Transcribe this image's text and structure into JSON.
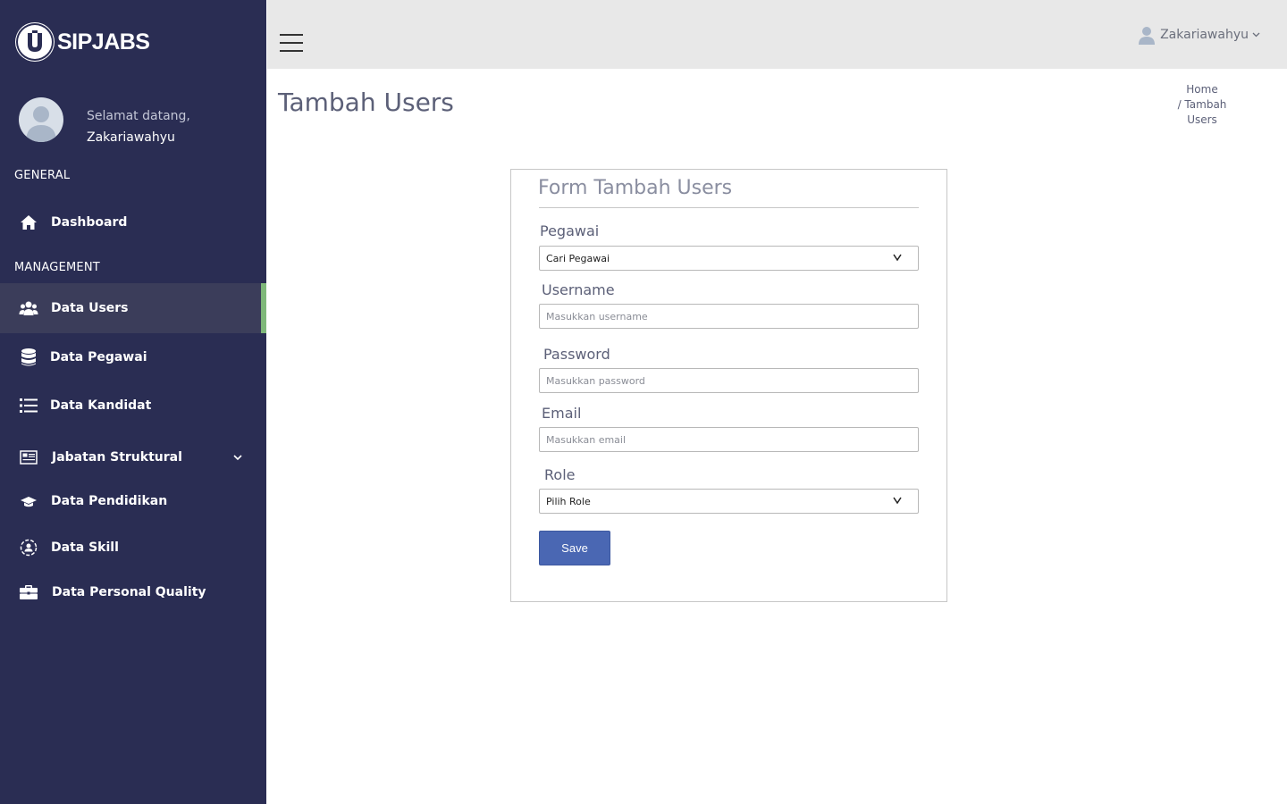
{
  "app": {
    "brand_name": "SIPJABS"
  },
  "sidebar": {
    "welcome": "Selamat datang,",
    "username": "Zakariawahyu",
    "sections": {
      "general": "GENERAL",
      "management": "MANAGEMENT"
    },
    "items": [
      {
        "label": "Dashboard",
        "icon": "home-icon"
      },
      {
        "label": "Data Users",
        "icon": "users-icon",
        "active": true
      },
      {
        "label": "Data Pegawai",
        "icon": "database-icon"
      },
      {
        "label": "Data Kandidat",
        "icon": "list-icon"
      },
      {
        "label": "Jabatan Struktural",
        "icon": "structure-icon",
        "has_submenu": true
      },
      {
        "label": "Data Pendidikan",
        "icon": "graduation-cap-icon"
      },
      {
        "label": "Data Skill",
        "icon": "skill-icon"
      },
      {
        "label": "Data Personal Quality",
        "icon": "briefcase-icon"
      }
    ]
  },
  "topbar": {
    "user_name": "Zakariawahyu"
  },
  "page": {
    "title": "Tambah Users",
    "breadcrumb": {
      "home": "Home",
      "current": "/ Tambah Users"
    }
  },
  "form": {
    "title": "Form Tambah Users",
    "pegawai": {
      "label": "Pegawai",
      "value": "Cari Pegawai"
    },
    "username": {
      "label": "Username",
      "placeholder": "Masukkan username"
    },
    "password": {
      "label": "Password",
      "placeholder": "Masukkan password"
    },
    "email": {
      "label": "Email",
      "placeholder": "Masukkan email"
    },
    "role": {
      "label": "Role",
      "value": "Pilih Role"
    },
    "save_label": "Save"
  },
  "colors": {
    "sidebar_bg": "#2a2d53",
    "active_item_bg": "#3b3d5a",
    "active_indicator": "#7fb87a",
    "topbar_bg": "#e8e8e8",
    "primary_button": "#4a67b3"
  }
}
